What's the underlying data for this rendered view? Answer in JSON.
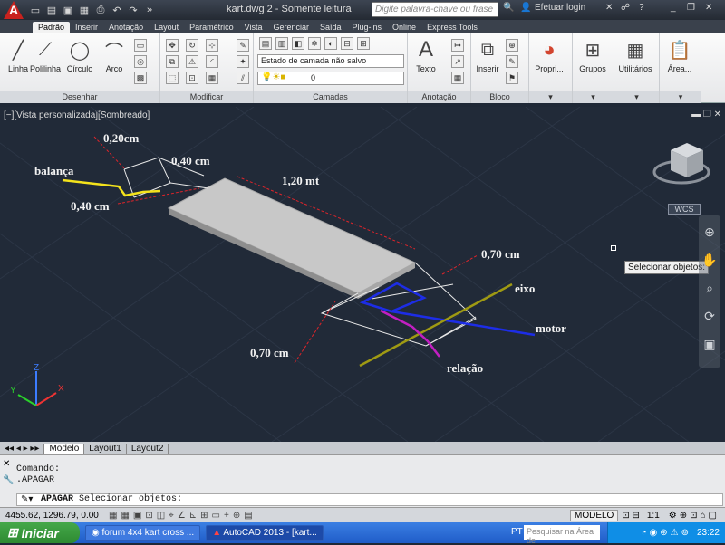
{
  "window": {
    "title": "kart.dwg 2 - Somente leitura",
    "search_placeholder": "Digite palavra-chave ou frase",
    "login": "Efetuar login"
  },
  "tabs": [
    "Padrão",
    "Inserir",
    "Anotação",
    "Layout",
    "Paramétrico",
    "Vista",
    "Gerenciar",
    "Saída",
    "Plug-ins",
    "Online",
    "Express Tools"
  ],
  "ribbon": {
    "draw_tools": [
      "Linha",
      "Polilinha",
      "Círculo",
      "Arco"
    ],
    "draw_panel": "Desenhar",
    "modify_panel": "Modificar",
    "layer_state": "Estado de camada não salvo",
    "layer_current": "0",
    "layers_panel": "Camadas",
    "text_tool": "Texto",
    "annotation_panel": "Anotação",
    "insert_tool": "Inserir",
    "block_panel": "Bloco",
    "properties_tool": "Propri...",
    "groups_tool": "Grupos",
    "utilities_tool": "Utilitários",
    "area_tool": "Área..."
  },
  "viewport": {
    "label": "[−][Vista personalizada][Sombreado]",
    "wcs": "WCS",
    "tooltip": "Selecionar objetos:"
  },
  "drawing_labels": {
    "dim_020": "0,20cm",
    "dim_040_top": "0,40 cm",
    "balanca": "balança",
    "dim_040_left": "0,40 cm",
    "dim_120": "1,20 mt",
    "dim_070_right": "0,70 cm",
    "eixo": "eixo",
    "motor": "motor",
    "dim_070_bottom": "0,70 cm",
    "relacao": "relação"
  },
  "layout_tabs": [
    "Modelo",
    "Layout1",
    "Layout2"
  ],
  "command": {
    "history": [
      "Comando:",
      ".APAGAR"
    ],
    "prompt_name": "APAGAR",
    "prompt_text": "Selecionar objetos:"
  },
  "status": {
    "coordinates": "4455.62, 1296.79, 0.00",
    "model": "MODELO",
    "scale": "1:1"
  },
  "taskbar": {
    "start": "Iniciar",
    "tasks": [
      "forum 4x4 kart cross ...",
      "AutoCAD 2013 - [kart..."
    ],
    "lang": "PT",
    "search": "Pesquisar na Área de",
    "clock": "23:22"
  }
}
